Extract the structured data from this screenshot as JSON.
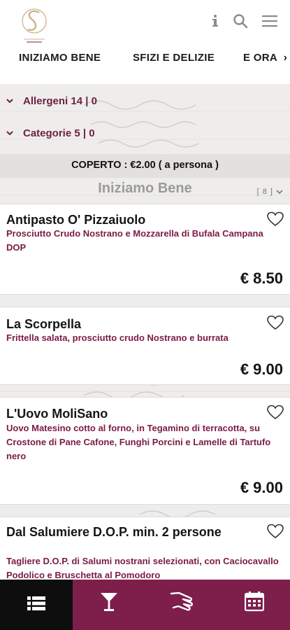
{
  "header": {
    "logo_icon": "restaurant-s-logo",
    "info_icon": "info-icon",
    "search_icon": "search-icon",
    "menu_icon": "hamburger-menu-icon"
  },
  "tabs": [
    {
      "label": "INIZIAMO BENE"
    },
    {
      "label": "SFIZI E DELIZIE"
    },
    {
      "label": "E ORA"
    }
  ],
  "filters": {
    "allergeni": "Allergeni 14 | 0",
    "categorie": "Categorie 5 | 0"
  },
  "coperto": "COPERTO : €2.00 ( a persona )",
  "section": {
    "title": "Iniziamo Bene",
    "count": "[ 8 ]"
  },
  "items": [
    {
      "name": "Antipasto O' Pizzaiuolo",
      "desc": "Prosciutto Crudo Nostrano e Mozzarella di Bufala Campana DOP",
      "price": "€ 8.50"
    },
    {
      "name": "La Scorpella",
      "desc": "Frittella salata, prosciutto crudo Nostrano e burrata",
      "price": "€ 9.00"
    },
    {
      "name": "L'Uovo MoliSano",
      "desc": "Uovo Matesino cotto al forno, in Tegamino di terracotta, su Crostone di Pane Cafone, Funghi Porcini e Lamelle di Tartufo nero",
      "price": "€ 9.00"
    },
    {
      "name": "Dal Salumiere D.O.P. min. 2 persone",
      "desc": "Tagliere D.O.P. di Salumi nostrani selezionati, con Caciocavallo Podolico e Bruschetta al Pomodoro",
      "price": ""
    }
  ],
  "bottom_nav": [
    {
      "icon": "menu-list-icon",
      "active": true
    },
    {
      "icon": "cocktail-glass-icon",
      "active": false
    },
    {
      "icon": "serving-hand-icon",
      "active": false
    },
    {
      "icon": "calendar-icon",
      "active": false
    }
  ],
  "colors": {
    "accent": "#7d1e4b",
    "description_text": "#7a1b45",
    "nav_active": "#0e0e0e"
  }
}
